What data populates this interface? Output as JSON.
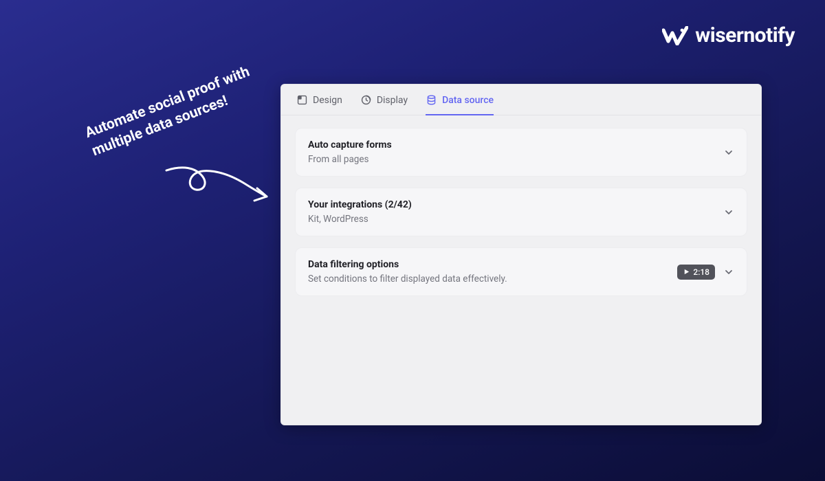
{
  "brand": {
    "name": "wisernotify"
  },
  "headline": "Automate social proof with\nmultiple data sources!",
  "tabs": [
    {
      "label": "Design",
      "active": false
    },
    {
      "label": "Display",
      "active": false
    },
    {
      "label": "Data source",
      "active": true
    }
  ],
  "sections": [
    {
      "title": "Auto capture forms",
      "subtitle": "From all pages"
    },
    {
      "title": "Your integrations (2/42)",
      "subtitle": "Kit, WordPress"
    },
    {
      "title": "Data filtering options",
      "subtitle": "Set conditions to filter displayed data effectively.",
      "video_duration": "2:18"
    }
  ]
}
